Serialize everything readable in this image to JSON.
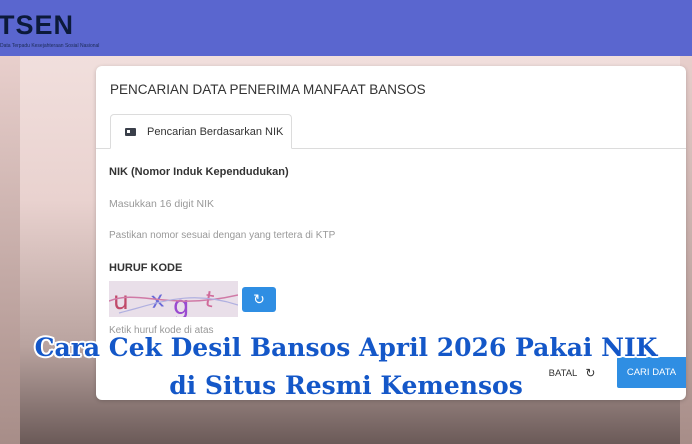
{
  "header": {
    "logo_text": "TSEN",
    "logo_subtext": "Data Terpadu Kesejahteraan Sosial Nasional"
  },
  "card": {
    "title": "PENCARIAN DATA PENERIMA MANFAAT BANSOS",
    "tab_label": "Pencarian Berdasarkan NIK",
    "nik_label": "NIK (Nomor Induk Kependudukan)",
    "nik_placeholder": "Masukkan 16 digit NIK",
    "nik_hint": "Pastikan nomor sesuai dengan yang tertera di KTP",
    "captcha_label": "HURUF KODE",
    "captcha_text": "uxgt",
    "captcha_hint": "Ketik huruf kode di atas",
    "batal_label": "BATAL",
    "cari_label": "CARI DATA"
  },
  "overlay": {
    "line1": "Cara Cek Desil Bansos April 2026 Pakai NIK",
    "line2": "di Situs Resmi Kemensos"
  },
  "colors": {
    "navbar": "#5a66cf",
    "accent": "#2f8ee3",
    "overlay_text": "#1457c8"
  },
  "icons": {
    "tab": "id-card-icon",
    "refresh": "refresh-icon",
    "reset": "reset-icon"
  }
}
